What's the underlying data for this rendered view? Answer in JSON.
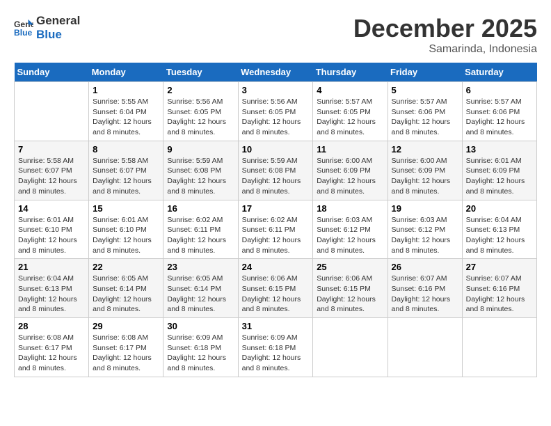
{
  "logo": {
    "line1": "General",
    "line2": "Blue"
  },
  "title": "December 2025",
  "subtitle": "Samarinda, Indonesia",
  "header": {
    "days": [
      "Sunday",
      "Monday",
      "Tuesday",
      "Wednesday",
      "Thursday",
      "Friday",
      "Saturday"
    ]
  },
  "weeks": [
    [
      {
        "day": "",
        "info": ""
      },
      {
        "day": "1",
        "info": "Sunrise: 5:55 AM\nSunset: 6:04 PM\nDaylight: 12 hours\nand 8 minutes."
      },
      {
        "day": "2",
        "info": "Sunrise: 5:56 AM\nSunset: 6:05 PM\nDaylight: 12 hours\nand 8 minutes."
      },
      {
        "day": "3",
        "info": "Sunrise: 5:56 AM\nSunset: 6:05 PM\nDaylight: 12 hours\nand 8 minutes."
      },
      {
        "day": "4",
        "info": "Sunrise: 5:57 AM\nSunset: 6:05 PM\nDaylight: 12 hours\nand 8 minutes."
      },
      {
        "day": "5",
        "info": "Sunrise: 5:57 AM\nSunset: 6:06 PM\nDaylight: 12 hours\nand 8 minutes."
      },
      {
        "day": "6",
        "info": "Sunrise: 5:57 AM\nSunset: 6:06 PM\nDaylight: 12 hours\nand 8 minutes."
      }
    ],
    [
      {
        "day": "7",
        "info": "Sunrise: 5:58 AM\nSunset: 6:07 PM\nDaylight: 12 hours\nand 8 minutes."
      },
      {
        "day": "8",
        "info": "Sunrise: 5:58 AM\nSunset: 6:07 PM\nDaylight: 12 hours\nand 8 minutes."
      },
      {
        "day": "9",
        "info": "Sunrise: 5:59 AM\nSunset: 6:08 PM\nDaylight: 12 hours\nand 8 minutes."
      },
      {
        "day": "10",
        "info": "Sunrise: 5:59 AM\nSunset: 6:08 PM\nDaylight: 12 hours\nand 8 minutes."
      },
      {
        "day": "11",
        "info": "Sunrise: 6:00 AM\nSunset: 6:09 PM\nDaylight: 12 hours\nand 8 minutes."
      },
      {
        "day": "12",
        "info": "Sunrise: 6:00 AM\nSunset: 6:09 PM\nDaylight: 12 hours\nand 8 minutes."
      },
      {
        "day": "13",
        "info": "Sunrise: 6:01 AM\nSunset: 6:09 PM\nDaylight: 12 hours\nand 8 minutes."
      }
    ],
    [
      {
        "day": "14",
        "info": "Sunrise: 6:01 AM\nSunset: 6:10 PM\nDaylight: 12 hours\nand 8 minutes."
      },
      {
        "day": "15",
        "info": "Sunrise: 6:01 AM\nSunset: 6:10 PM\nDaylight: 12 hours\nand 8 minutes."
      },
      {
        "day": "16",
        "info": "Sunrise: 6:02 AM\nSunset: 6:11 PM\nDaylight: 12 hours\nand 8 minutes."
      },
      {
        "day": "17",
        "info": "Sunrise: 6:02 AM\nSunset: 6:11 PM\nDaylight: 12 hours\nand 8 minutes."
      },
      {
        "day": "18",
        "info": "Sunrise: 6:03 AM\nSunset: 6:12 PM\nDaylight: 12 hours\nand 8 minutes."
      },
      {
        "day": "19",
        "info": "Sunrise: 6:03 AM\nSunset: 6:12 PM\nDaylight: 12 hours\nand 8 minutes."
      },
      {
        "day": "20",
        "info": "Sunrise: 6:04 AM\nSunset: 6:13 PM\nDaylight: 12 hours\nand 8 minutes."
      }
    ],
    [
      {
        "day": "21",
        "info": "Sunrise: 6:04 AM\nSunset: 6:13 PM\nDaylight: 12 hours\nand 8 minutes."
      },
      {
        "day": "22",
        "info": "Sunrise: 6:05 AM\nSunset: 6:14 PM\nDaylight: 12 hours\nand 8 minutes."
      },
      {
        "day": "23",
        "info": "Sunrise: 6:05 AM\nSunset: 6:14 PM\nDaylight: 12 hours\nand 8 minutes."
      },
      {
        "day": "24",
        "info": "Sunrise: 6:06 AM\nSunset: 6:15 PM\nDaylight: 12 hours\nand 8 minutes."
      },
      {
        "day": "25",
        "info": "Sunrise: 6:06 AM\nSunset: 6:15 PM\nDaylight: 12 hours\nand 8 minutes."
      },
      {
        "day": "26",
        "info": "Sunrise: 6:07 AM\nSunset: 6:16 PM\nDaylight: 12 hours\nand 8 minutes."
      },
      {
        "day": "27",
        "info": "Sunrise: 6:07 AM\nSunset: 6:16 PM\nDaylight: 12 hours\nand 8 minutes."
      }
    ],
    [
      {
        "day": "28",
        "info": "Sunrise: 6:08 AM\nSunset: 6:17 PM\nDaylight: 12 hours\nand 8 minutes."
      },
      {
        "day": "29",
        "info": "Sunrise: 6:08 AM\nSunset: 6:17 PM\nDaylight: 12 hours\nand 8 minutes."
      },
      {
        "day": "30",
        "info": "Sunrise: 6:09 AM\nSunset: 6:18 PM\nDaylight: 12 hours\nand 8 minutes."
      },
      {
        "day": "31",
        "info": "Sunrise: 6:09 AM\nSunset: 6:18 PM\nDaylight: 12 hours\nand 8 minutes."
      },
      {
        "day": "",
        "info": ""
      },
      {
        "day": "",
        "info": ""
      },
      {
        "day": "",
        "info": ""
      }
    ]
  ]
}
